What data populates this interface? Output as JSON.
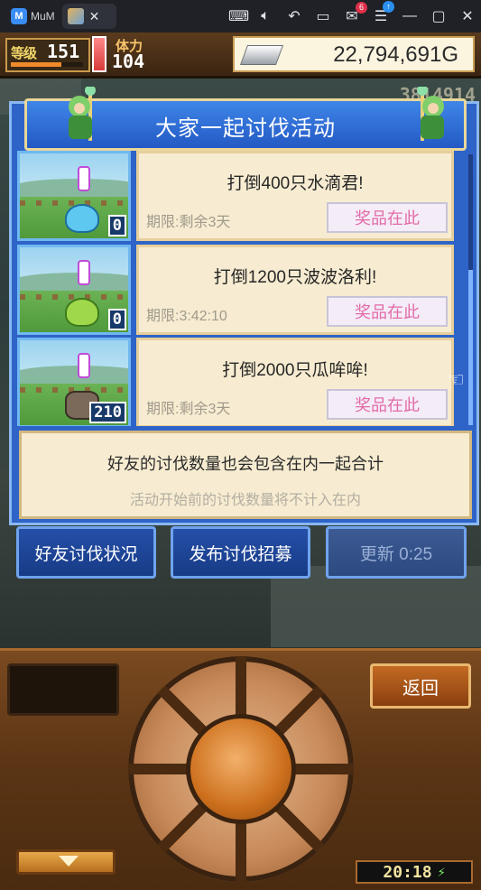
{
  "titlebar": {
    "app_name": "MuM",
    "close_glyph": "✕",
    "mail_badge": "6",
    "update_badge": "↑",
    "icons": [
      "keyboard-icon",
      "volume-icon",
      "undo-icon",
      "screen-icon",
      "mail-icon",
      "menu-icon",
      "minimize-icon",
      "restore-icon",
      "close-icon"
    ]
  },
  "hud": {
    "level_label": "等级",
    "level_value": "151",
    "level_progress": 0.7,
    "stamina_label": "体力",
    "stamina_value": "104",
    "gold_value": "22,794,691G"
  },
  "background": {
    "score_partial": "3814914"
  },
  "dialog": {
    "title": "大家一起讨伐活动",
    "events": [
      {
        "title": "打倒400只水滴君!",
        "deadline": "期限:剩余3天",
        "prize_label": "奖品在此",
        "count": "0",
        "monster": "slime"
      },
      {
        "title": "打倒1200只波波洛利!",
        "deadline": "期限:3:42:10",
        "prize_label": "奖品在此",
        "count": "0",
        "monster": "pea"
      },
      {
        "title": "打倒2000只瓜哞哞!",
        "deadline": "期限:剩余3天",
        "prize_label": "奖品在此",
        "count": "210",
        "monster": "cat"
      }
    ],
    "info_line1": "好友的讨伐数量也会包含在内一起合计",
    "info_line2": "活动开始前的讨伐数量将不计入在内"
  },
  "actions": {
    "friend_status": "好友讨伐状况",
    "post_recruit": "发布讨伐招募",
    "refresh": "更新 0:25"
  },
  "console": {
    "back_label": "返回",
    "clock": "20:18",
    "battery_glyph": "⚡"
  },
  "colors": {
    "dialog_blue": "#2e63c8",
    "card_cream": "#f7ecd1",
    "prize_pink": "#e26aa8",
    "console_brown": "#5a3414"
  }
}
